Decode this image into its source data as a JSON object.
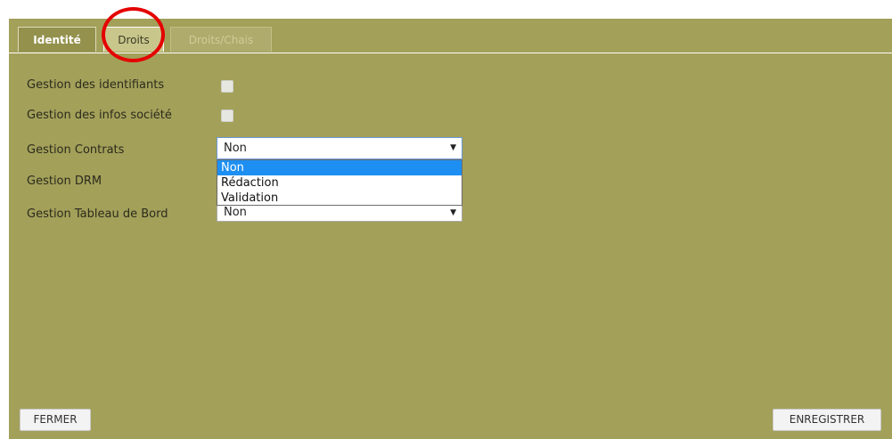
{
  "tabs": [
    {
      "label": "Identité"
    },
    {
      "label": "Droits"
    },
    {
      "label": "Droits/Chais"
    }
  ],
  "form": {
    "identifiants_label": "Gestion des identifiants",
    "infos_societe_label": "Gestion des infos société",
    "contrats_label": "Gestion Contrats",
    "contrats_value": "Non",
    "drm_label": "Gestion DRM",
    "tableau_label": "Gestion Tableau de Bord",
    "tableau_value": "Non",
    "dropdown_options": [
      "Non",
      "Rédaction",
      "Validation"
    ],
    "dropdown_selected": "Non"
  },
  "buttons": {
    "fermer": "FERMER",
    "enregistrer": "ENREGISTRER"
  },
  "colors": {
    "panel_bg": "#a3a05a",
    "highlight_circle": "#e50000",
    "selected_option": "#1e8ff2"
  }
}
